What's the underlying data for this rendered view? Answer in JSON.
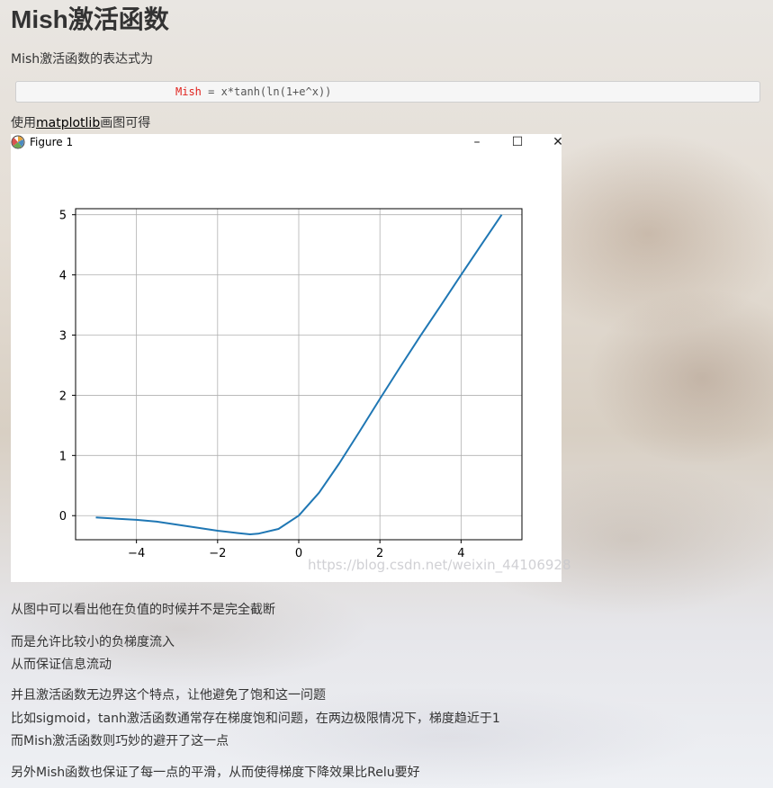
{
  "article": {
    "title": "Mish激活函数",
    "intro": "Mish激活函数的表达式为",
    "code": {
      "keyword": "Mish",
      "rest": " = x*tanh(ln(1+e^x))"
    },
    "plot_line": {
      "prefix": "使用",
      "link": "matplotlib",
      "suffix": "画图可得"
    },
    "paragraphs": [
      "从图中可以看出他在负值的时候并不是完全截断",
      "而是允许比较小的负梯度流入",
      "从而保证信息流动",
      "并且激活函数无边界这个特点，让他避免了饱和这一问题",
      "比如sigmoid，tanh激活函数通常存在梯度饱和问题，在两边极限情况下，梯度趋近于1",
      "而Mish激活函数则巧妙的避开了这一点",
      "另外Mish函数也保证了每一点的平滑，从而使得梯度下降效果比Relu要好"
    ]
  },
  "figure": {
    "title": "Figure 1",
    "icon": "matplotlib-icon",
    "controls": {
      "minimize": "–",
      "maximize": "☐",
      "close": "✕"
    },
    "watermark": "https://blog.csdn.net/weixin_44106928"
  },
  "chart_data": {
    "type": "line",
    "title": "",
    "xlabel": "",
    "ylabel": "",
    "xlim": [
      -5.5,
      5.5
    ],
    "ylim": [
      -0.4,
      5.1
    ],
    "xticks": [
      -4,
      -2,
      0,
      2,
      4
    ],
    "yticks": [
      0,
      1,
      2,
      3,
      4,
      5
    ],
    "xtick_labels": [
      "−4",
      "−2",
      "0",
      "2",
      "4"
    ],
    "ytick_labels": [
      "0",
      "1",
      "2",
      "3",
      "4",
      "5"
    ],
    "grid": true,
    "color": "#1f77b4",
    "series": [
      {
        "x": [
          -5,
          -4.5,
          -4,
          -3.5,
          -3,
          -2.5,
          -2,
          -1.5,
          -1.2,
          -1,
          -0.5,
          0,
          0.5,
          1,
          1.5,
          2,
          2.5,
          3,
          3.5,
          4,
          4.5,
          5
        ],
        "y": [
          -0.03,
          -0.05,
          -0.07,
          -0.1,
          -0.15,
          -0.2,
          -0.25,
          -0.29,
          -0.31,
          -0.3,
          -0.22,
          0,
          0.38,
          0.87,
          1.4,
          1.94,
          2.47,
          2.99,
          3.49,
          4.0,
          4.5,
          5.0
        ]
      }
    ]
  }
}
